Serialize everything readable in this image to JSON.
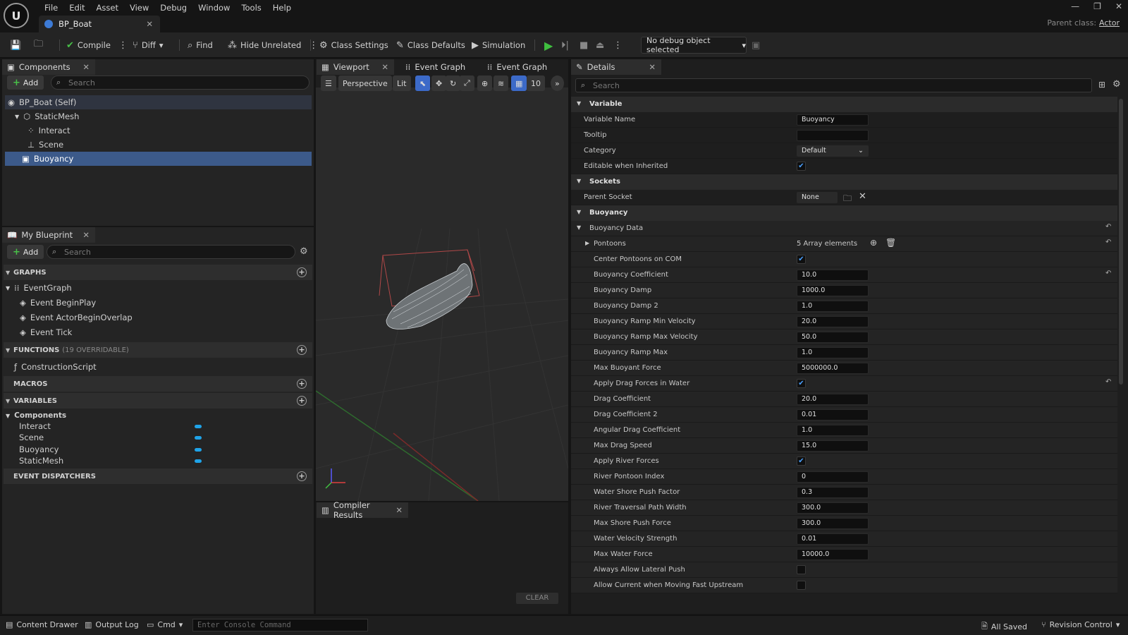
{
  "menu": [
    "File",
    "Edit",
    "Asset",
    "View",
    "Debug",
    "Window",
    "Tools",
    "Help"
  ],
  "doc_tab": "BP_Boat",
  "parent_class_label": "Parent class:",
  "parent_class_value": "Actor",
  "toolbar": {
    "compile": "Compile",
    "diff": "Diff",
    "find": "Find",
    "hide_unrelated": "Hide Unrelated",
    "class_settings": "Class Settings",
    "class_defaults": "Class Defaults",
    "simulation": "Simulation",
    "debug_object": "No debug object selected"
  },
  "components": {
    "tab": "Components",
    "add": "Add",
    "search_placeholder": "Search",
    "items": [
      "BP_Boat (Self)",
      "StaticMesh",
      "Interact",
      "Scene",
      "Buoyancy"
    ]
  },
  "my_blueprint": {
    "tab": "My Blueprint",
    "add": "Add",
    "search_placeholder": "Search",
    "graphs_header": "GRAPHS",
    "event_graph": "EventGraph",
    "events": [
      "Event BeginPlay",
      "Event ActorBeginOverlap",
      "Event Tick"
    ],
    "functions_header": "FUNCTIONS",
    "functions_count": "(19 OVERRIDABLE)",
    "construction_script": "ConstructionScript",
    "macros_header": "MACROS",
    "variables_header": "VARIABLES",
    "components_group": "Components",
    "variables": [
      "Interact",
      "Scene",
      "Buoyancy",
      "StaticMesh"
    ],
    "dispatchers_header": "EVENT DISPATCHERS",
    "pill_color": "#1fa3e8"
  },
  "viewport": {
    "tabs": [
      "Viewport",
      "Event Graph",
      "Event Graph"
    ],
    "perspective": "Perspective",
    "lit": "Lit",
    "grid_value": "10"
  },
  "compiler": {
    "tab": "Compiler Results",
    "clear": "CLEAR"
  },
  "details": {
    "tab": "Details",
    "search_placeholder": "Search",
    "variable_section": "Variable",
    "variable_name_label": "Variable Name",
    "variable_name_value": "Buoyancy",
    "tooltip_label": "Tooltip",
    "tooltip_value": "",
    "category_label": "Category",
    "category_value": "Default",
    "editable_label": "Editable when Inherited",
    "sockets_section": "Sockets",
    "parent_socket_label": "Parent Socket",
    "parent_socket_value": "None",
    "buoyancy_section": "Buoyancy",
    "buoyancy_data": "Buoyancy Data",
    "pontoons_label": "Pontoons",
    "pontoons_value": "5 Array elements",
    "center_pontoons_label": "Center Pontoons on COM",
    "props": [
      {
        "label": "Buoyancy Coefficient",
        "value": "10.0"
      },
      {
        "label": "Buoyancy Damp",
        "value": "1000.0"
      },
      {
        "label": "Buoyancy Damp 2",
        "value": "1.0"
      },
      {
        "label": "Buoyancy Ramp Min Velocity",
        "value": "20.0"
      },
      {
        "label": "Buoyancy Ramp Max Velocity",
        "value": "50.0"
      },
      {
        "label": "Buoyancy Ramp Max",
        "value": "1.0"
      },
      {
        "label": "Max Buoyant Force",
        "value": "5000000.0"
      }
    ],
    "apply_drag_label": "Apply Drag Forces in Water",
    "props2": [
      {
        "label": "Drag Coefficient",
        "value": "20.0"
      },
      {
        "label": "Drag Coefficient 2",
        "value": "0.01"
      },
      {
        "label": "Angular Drag Coefficient",
        "value": "1.0"
      },
      {
        "label": "Max Drag Speed",
        "value": "15.0"
      }
    ],
    "apply_river_label": "Apply River Forces",
    "props3": [
      {
        "label": "River Pontoon Index",
        "value": "0"
      },
      {
        "label": "Water Shore Push Factor",
        "value": "0.3"
      },
      {
        "label": "River Traversal Path Width",
        "value": "300.0"
      },
      {
        "label": "Max Shore Push Force",
        "value": "300.0"
      },
      {
        "label": "Water Velocity Strength",
        "value": "0.01"
      },
      {
        "label": "Max Water Force",
        "value": "10000.0"
      }
    ],
    "always_lateral_label": "Always Allow Lateral Push",
    "allow_current_label": "Allow Current when Moving Fast Upstream"
  },
  "status": {
    "content_drawer": "Content Drawer",
    "output_log": "Output Log",
    "cmd": "Cmd",
    "console_placeholder": "Enter Console Command",
    "all_saved": "All Saved",
    "revision_control": "Revision Control"
  }
}
